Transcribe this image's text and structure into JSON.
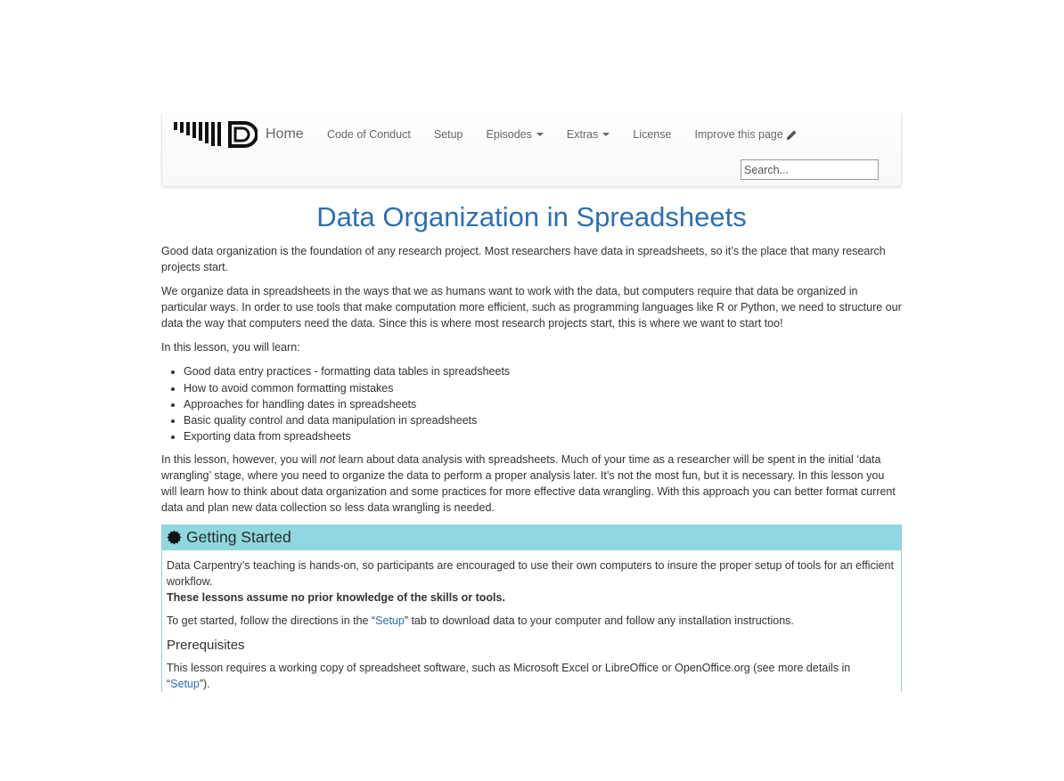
{
  "navbar": {
    "brand_label": "Home",
    "items": [
      {
        "label": "Code of Conduct"
      },
      {
        "label": "Setup"
      },
      {
        "label": "Episodes"
      },
      {
        "label": "Extras"
      },
      {
        "label": "License"
      },
      {
        "label": "Improve this page"
      }
    ],
    "search_placeholder": "Search..."
  },
  "title": "Data Organization in Spreadsheets",
  "intro": {
    "p1": "Good data organization is the foundation of any research project. Most researchers have data in spreadsheets, so it’s the place that many research projects start.",
    "p2": "We organize data in spreadsheets in the ways that we as humans want to work with the data, but computers require that data be organized in particular ways. In order to use tools that make computation more efficient, such as programming languages like R or Python, we need to structure our data the way that computers need the data. Since this is where most research projects start, this is where we want to start too!",
    "p3": "In this lesson, you will learn:"
  },
  "learn_list": [
    "Good data entry practices - formatting data tables in spreadsheets",
    "How to avoid common formatting mistakes",
    "Approaches for handling dates in spreadsheets",
    "Basic quality control and data manipulation in spreadsheets",
    "Exporting data from spreadsheets"
  ],
  "outro": {
    "before": "In this lesson, however, you will ",
    "emph": "not",
    "after": " learn about data analysis with spreadsheets. Much of your time as a researcher will be spent in the initial ‘data wrangling’ stage, where you need to organize the data to perform a proper analysis later. It’s not the most fun, but it is necessary. In this lesson you will learn how to think about data organization and some practices for more effective data wrangling. With this approach you can better format current data and plan new data collection so less data wrangling is needed."
  },
  "callout": {
    "title": "Getting Started",
    "p1": "Data Carpentry’s teaching is hands-on, so participants are encouraged to use their own computers to insure the proper setup of tools for an efficient workflow.",
    "p1_strong": "These lessons assume no prior knowledge of the skills or tools.",
    "p2_before": "To get started, follow the directions in the “",
    "p2_link": "Setup",
    "p2_after": "” tab to download data to your computer and follow any installation instructions.",
    "prereq_heading": "Prerequisites",
    "p3_before": "This lesson requires a working copy of spreadsheet software, such as Microsoft Excel or LibreOffice or OpenOffice.org (see more details in “",
    "p3_link": "Setup",
    "p3_after": "”)."
  }
}
